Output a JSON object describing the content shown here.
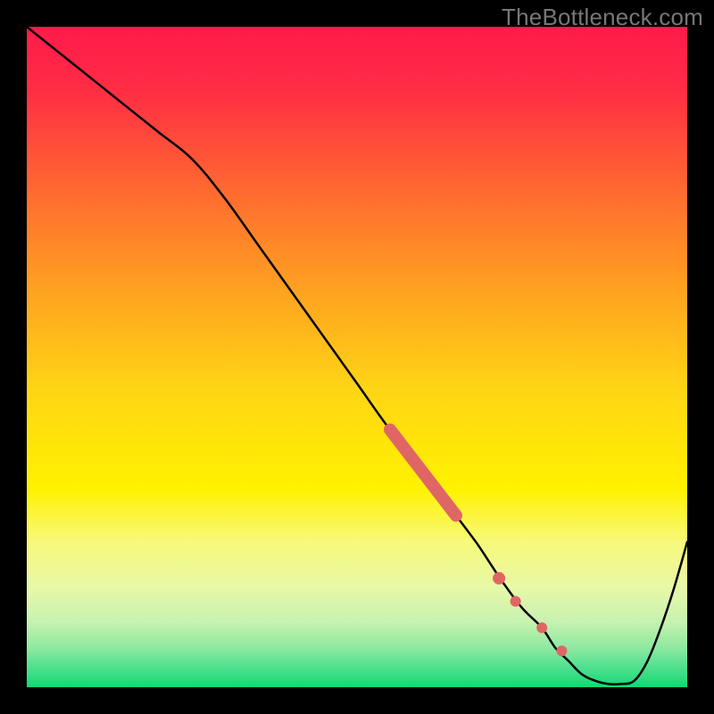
{
  "watermark": "TheBottleneck.com",
  "chart_data": {
    "type": "line",
    "title": "",
    "xlabel": "",
    "ylabel": "",
    "xlim": [
      0,
      100
    ],
    "ylim": [
      0,
      100
    ],
    "x": [
      0,
      5,
      10,
      15,
      20,
      25,
      30,
      35,
      40,
      45,
      50,
      55,
      60,
      62,
      65,
      68,
      70,
      72,
      75,
      78,
      80,
      82,
      84,
      86,
      88,
      90,
      92,
      94,
      96,
      98,
      100
    ],
    "y": [
      100,
      96,
      92,
      88,
      84,
      80,
      74,
      67,
      60,
      53,
      46,
      39,
      33,
      30,
      26,
      22,
      19,
      16,
      12,
      9,
      6,
      4,
      2,
      1,
      0.5,
      0.5,
      1,
      4,
      9,
      15,
      22
    ],
    "highlight_segments": {
      "thick": {
        "x": [
          55,
          65
        ],
        "y": [
          39,
          26
        ]
      },
      "dots": [
        {
          "x": 71.5,
          "y": 16.5
        },
        {
          "x": 74,
          "y": 13
        },
        {
          "x": 78,
          "y": 9
        },
        {
          "x": 81,
          "y": 5.5
        }
      ]
    },
    "gradient_stops": [
      {
        "pos": 0.0,
        "color": "#ff1a4b"
      },
      {
        "pos": 0.1,
        "color": "#ff2e44"
      },
      {
        "pos": 0.25,
        "color": "#ff6a30"
      },
      {
        "pos": 0.4,
        "color": "#ffa220"
      },
      {
        "pos": 0.55,
        "color": "#ffd515"
      },
      {
        "pos": 0.7,
        "color": "#fff200"
      },
      {
        "pos": 0.78,
        "color": "#f7f97a"
      },
      {
        "pos": 0.85,
        "color": "#e7f8a8"
      },
      {
        "pos": 0.9,
        "color": "#c8f2b0"
      },
      {
        "pos": 0.94,
        "color": "#8fe9a0"
      },
      {
        "pos": 0.97,
        "color": "#4fe08f"
      },
      {
        "pos": 1.0,
        "color": "#13d873"
      }
    ],
    "highlight_color": "#e06666",
    "curve_color": "#000000"
  }
}
